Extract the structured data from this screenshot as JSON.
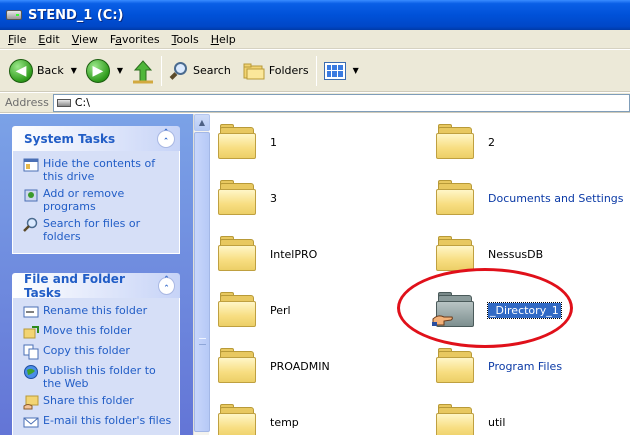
{
  "window": {
    "title": "STEND_1 (C:)",
    "drive_icon": "hard-drive-icon"
  },
  "menu": {
    "items": [
      {
        "label": "File",
        "accel": "F",
        "rest": "ile"
      },
      {
        "label": "Edit",
        "accel": "E",
        "rest": "dit"
      },
      {
        "label": "View",
        "accel": "V",
        "rest": "iew"
      },
      {
        "label": "Favorites",
        "accel": "a",
        "pre": "F",
        "rest": "vorites"
      },
      {
        "label": "Tools",
        "accel": "T",
        "rest": "ools"
      },
      {
        "label": "Help",
        "accel": "H",
        "rest": "elp"
      }
    ]
  },
  "toolbar": {
    "back_label": "Back",
    "search_label": "Search",
    "folders_label": "Folders"
  },
  "address": {
    "label": "Address",
    "value": "C:\\"
  },
  "system_tasks": {
    "title": "System Tasks",
    "items": [
      {
        "label": "Hide the contents of this drive",
        "icon": "hide-drive-icon"
      },
      {
        "label": "Add or remove programs",
        "icon": "add-remove-programs-icon"
      },
      {
        "label": "Search for files or folders",
        "icon": "search-icon"
      }
    ]
  },
  "file_folder_tasks": {
    "title": "File and Folder Tasks",
    "items": [
      {
        "label": "Rename this folder",
        "icon": "rename-icon"
      },
      {
        "label": "Move this folder",
        "icon": "move-icon"
      },
      {
        "label": "Copy this folder",
        "icon": "copy-icon"
      },
      {
        "label": "Publish this folder to the Web",
        "icon": "publish-web-icon"
      },
      {
        "label": "Share this folder",
        "icon": "share-icon"
      },
      {
        "label": "E-mail this folder's files",
        "icon": "email-icon"
      }
    ]
  },
  "folders": [
    {
      "name": "1",
      "style": "normal"
    },
    {
      "name": "2",
      "style": "normal"
    },
    {
      "name": "3",
      "style": "normal"
    },
    {
      "name": "Documents and Settings",
      "style": "blue"
    },
    {
      "name": "IntelPRO",
      "style": "normal"
    },
    {
      "name": "NessusDB",
      "style": "normal"
    },
    {
      "name": "Perl",
      "style": "normal"
    },
    {
      "name": "_Directory_1",
      "style": "selected",
      "shared": true
    },
    {
      "name": "PROADMIN",
      "style": "normal"
    },
    {
      "name": "Program Files",
      "style": "blue"
    },
    {
      "name": "temp",
      "style": "normal"
    },
    {
      "name": "util",
      "style": "normal"
    }
  ],
  "colors": {
    "title_bar": "#0051d8",
    "task_link": "#215dc6",
    "selection": "#316ac5",
    "annotation": "#e0101a"
  }
}
